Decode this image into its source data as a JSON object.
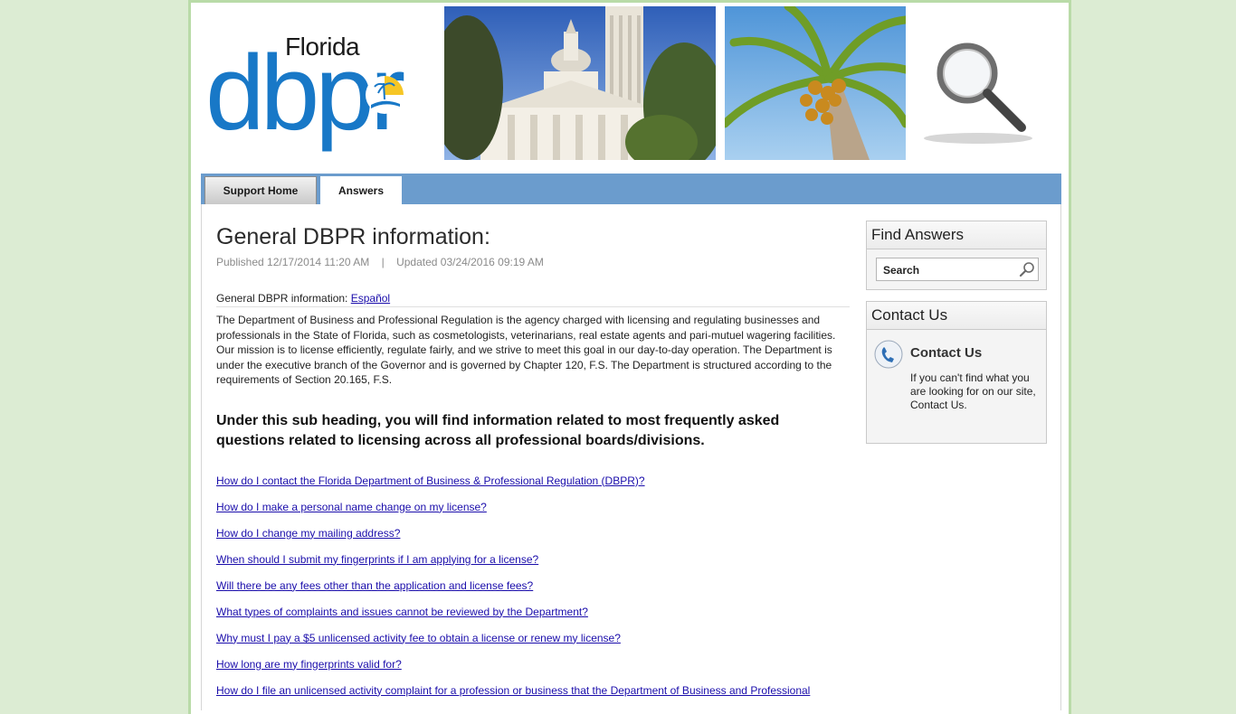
{
  "header": {
    "logo_state": "Florida",
    "logo_text": "dbpr"
  },
  "nav": {
    "tabs": [
      {
        "label": "Support Home"
      },
      {
        "label": "Answers"
      }
    ]
  },
  "article": {
    "title": "General DBPR information:",
    "published": "Published 12/17/2014 11:20 AM",
    "separator": "|",
    "updated": "Updated 03/24/2016 09:19 AM",
    "intro_label": "General DBPR information: ",
    "intro_link": "Español",
    "body": "The Department of Business and Professional Regulation is the agency charged with licensing and regulating businesses and professionals in the State of Florida, such as cosmetologists, veterinarians, real estate agents and pari-mutuel wagering facilities. Our mission is to license efficiently, regulate fairly, and we strive to meet this goal in our day-to-day operation. The Department is under the executive branch of the Governor and is governed by Chapter 120, F.S. The Department is structured according to the requirements of Section 20.165, F.S.",
    "subheading": "Under this sub heading, you will find information related to most frequently asked questions related to licensing across all professional boards/divisions.",
    "links": [
      "How do I contact the Florida Department of Business & Professional Regulation (DBPR)?",
      "How do I make a personal name change on my license?",
      "How do I change my mailing address?",
      "When should I submit my fingerprints if I am applying for a license?",
      "Will there be any fees other than the application and license fees?",
      "What types of complaints and issues cannot be reviewed by the Department?",
      "Why must I pay a $5 unlicensed activity fee to obtain a license or renew my license?",
      "How long are my fingerprints valid for?",
      "How do I file an unlicensed activity complaint for a profession or business that the Department of Business and Professional"
    ]
  },
  "sidebar": {
    "find_title": "Find Answers",
    "search_value": "Search",
    "contact_box_title": "Contact Us",
    "contact_title": "Contact Us",
    "contact_text": "If you can't find what you are looking for on our site, Contact Us."
  },
  "colors": {
    "page_bg": "#dcecd3",
    "nav_bg": "#6b9ccd",
    "logo_blue": "#1878c7",
    "link": "#1a0dab"
  }
}
